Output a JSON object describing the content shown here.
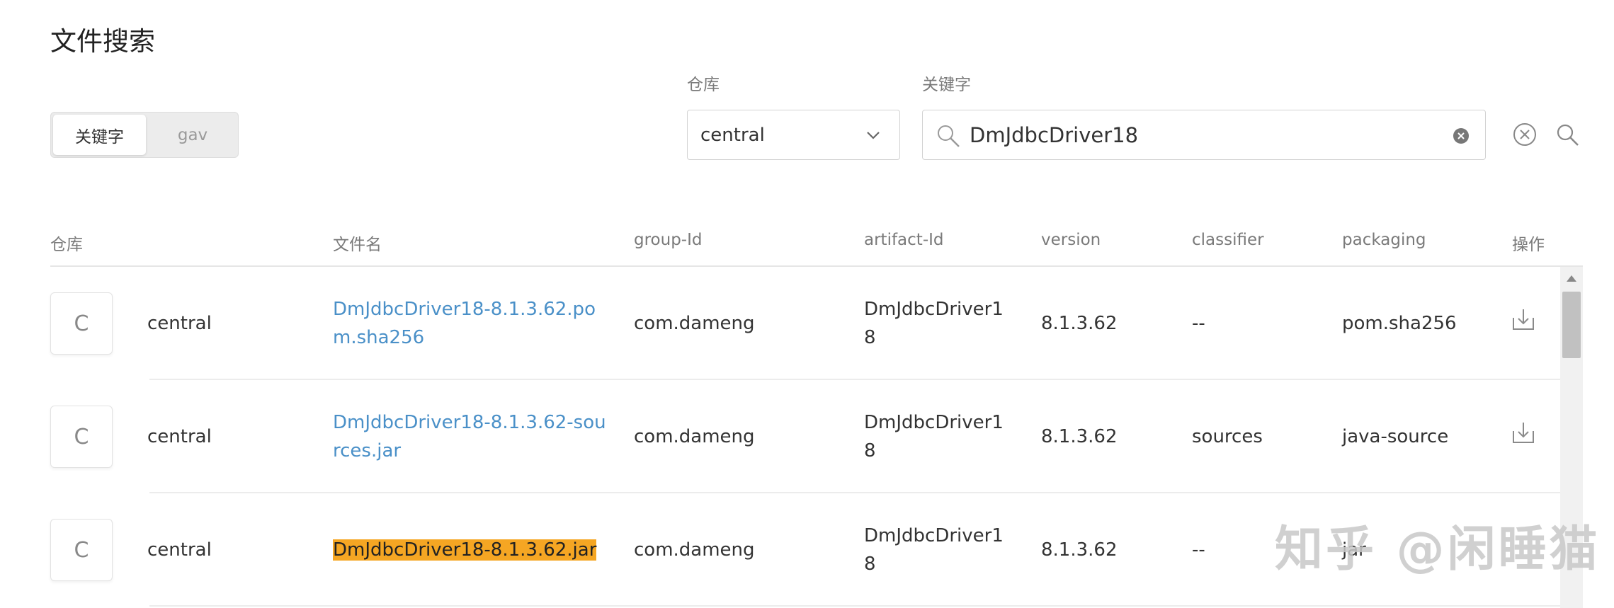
{
  "page": {
    "title": "文件搜索"
  },
  "search_mode": {
    "options": [
      "关键字",
      "gav"
    ],
    "active": "关键字"
  },
  "filters": {
    "repo_label": "仓库",
    "repo_value": "central",
    "keyword_label": "关键字",
    "keyword_value": "DmJdbcDriver18"
  },
  "table": {
    "headers": [
      "仓库",
      "文件名",
      "group-Id",
      "artifact-Id",
      "version",
      "classifier",
      "packaging",
      "操作"
    ],
    "rows": [
      {
        "avatar": "C",
        "repo": "central",
        "filename": "DmJdbcDriver18-8.1.3.62.pom.sha256",
        "group": "com.dameng",
        "artifact": "DmJdbcDriver18",
        "version": "8.1.3.62",
        "classifier": "--",
        "packaging": "pom.sha256"
      },
      {
        "avatar": "C",
        "repo": "central",
        "filename": "DmJdbcDriver18-8.1.3.62-sources.jar",
        "group": "com.dameng",
        "artifact": "DmJdbcDriver18",
        "version": "8.1.3.62",
        "classifier": "sources",
        "packaging": "java-source"
      },
      {
        "avatar": "C",
        "repo": "central",
        "filename": "DmJdbcDriver18-8.1.3.62.jar",
        "group": "com.dameng",
        "artifact": "DmJdbcDriver18",
        "version": "8.1.3.62",
        "classifier": "--",
        "packaging": "jar"
      }
    ]
  },
  "watermark": "知乎 @闲睡猫",
  "icons": [
    "search-icon",
    "chevron-down-icon",
    "clear-icon",
    "clear-circle-icon",
    "download-icon"
  ],
  "colors": {
    "link": "#4a90c8",
    "highlight": "#f5a623"
  }
}
